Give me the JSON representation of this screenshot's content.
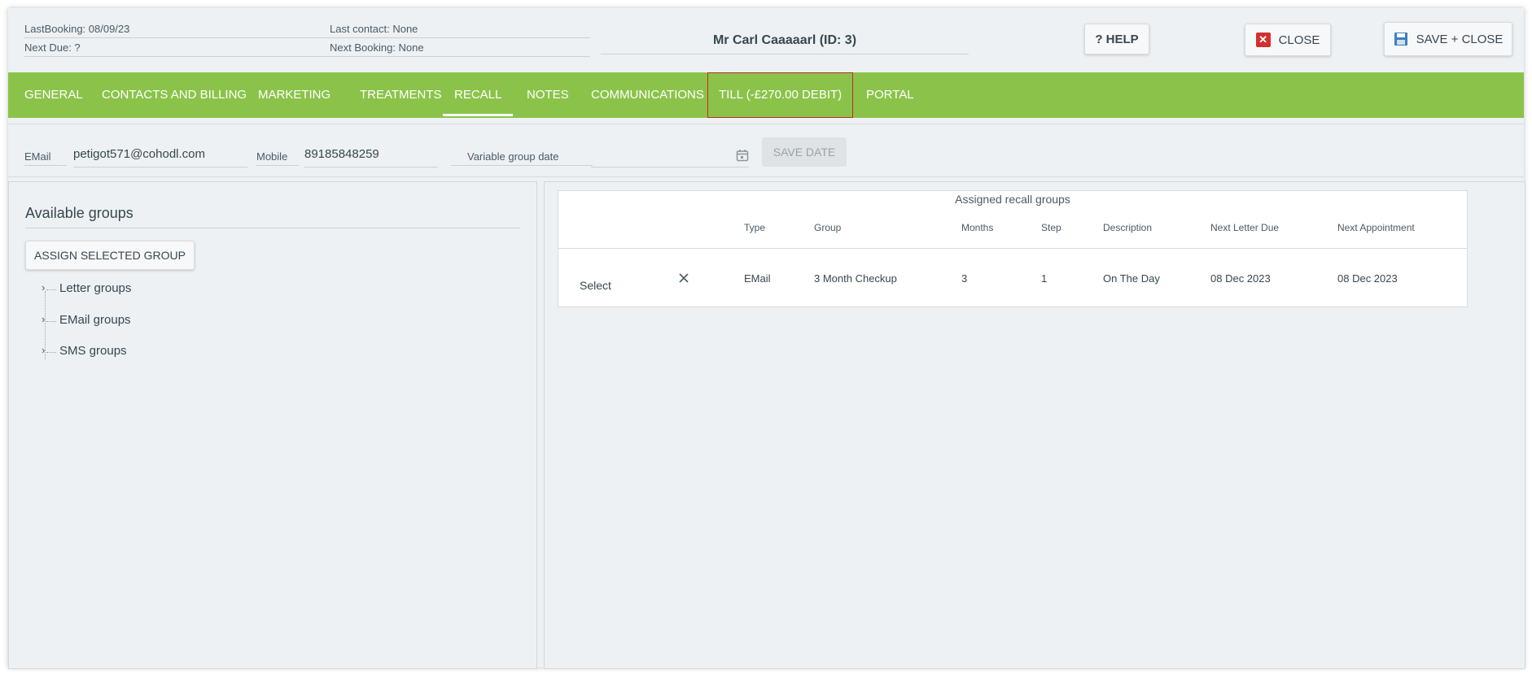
{
  "header": {
    "last_booking": "LastBooking: 08/09/23",
    "next_due": "Next Due: ?",
    "last_contact": "Last contact: None",
    "next_booking": "Next Booking: None",
    "patient_name": "Mr Carl Caaaaarl (ID: 3)",
    "help_label": "? HELP",
    "close_label": "CLOSE",
    "save_close_label": "SAVE + CLOSE"
  },
  "tabs": [
    {
      "label": "GENERAL"
    },
    {
      "label": "CONTACTS AND BILLING"
    },
    {
      "label": "MARKETING"
    },
    {
      "label": "TREATMENTS"
    },
    {
      "label": "RECALL",
      "active": true
    },
    {
      "label": "NOTES"
    },
    {
      "label": "COMMUNICATIONS"
    },
    {
      "label": "TILL (-£270.00 DEBIT)"
    },
    {
      "label": "PORTAL"
    }
  ],
  "fields": {
    "email_label": "EMail",
    "email_value": "petigot571@cohodl.com",
    "mobile_label": "Mobile",
    "mobile_value": "89185848259",
    "variable_date_label": "Variable group date",
    "variable_date_value": "",
    "save_date_label": "SAVE DATE"
  },
  "available": {
    "title": "Available groups",
    "assign_label": "ASSIGN SELECTED GROUP",
    "tree": [
      "Letter groups",
      "EMail groups",
      "SMS groups"
    ]
  },
  "assigned": {
    "title": "Assigned recall groups",
    "columns": [
      "Type",
      "Group",
      "Months",
      "Step",
      "Description",
      "Next Letter Due",
      "Next Appointment"
    ],
    "rows": [
      {
        "select": "Select",
        "type": "EMail",
        "group": "3 Month Checkup",
        "months": "3",
        "step": "1",
        "description": "On The Day",
        "next_letter_due": "08 Dec 2023",
        "next_appointment": "08 Dec 2023"
      }
    ]
  },
  "colors": {
    "tab_bar": "#8bc34a",
    "close_icon": "#d32f2f",
    "save_icon": "#3f7fbf"
  }
}
